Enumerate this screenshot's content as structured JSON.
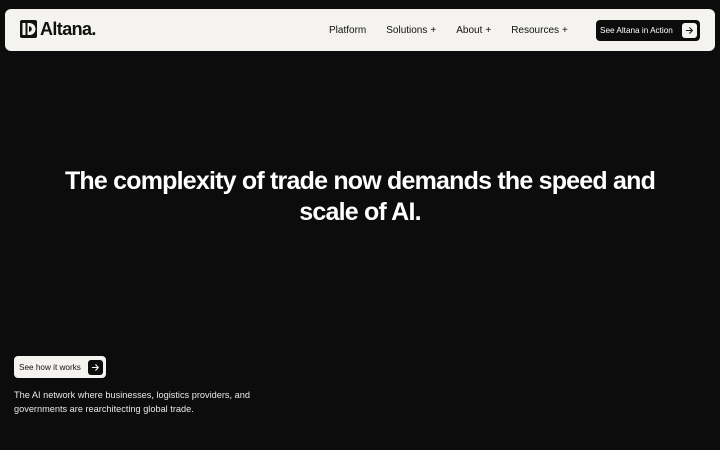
{
  "header": {
    "logo_text": "Altana.",
    "nav": [
      {
        "label": "Platform",
        "has_plus": false
      },
      {
        "label": "Solutions",
        "has_plus": true
      },
      {
        "label": "About",
        "has_plus": true
      },
      {
        "label": "Resources",
        "has_plus": true
      }
    ],
    "plus_symbol": "+",
    "cta_label": "See Altana in Action",
    "cta_icon": "arrow-right-icon"
  },
  "hero": {
    "headline": "The complexity of trade now demands the speed and scale of AI.",
    "cta_label": "See how it works",
    "cta_icon": "arrow-right-icon",
    "tagline": "The AI network where businesses, logistics providers, and governments are rearchitecting global trade."
  },
  "colors": {
    "background": "#0c0c0c",
    "navbar_background": "#f4f3ef",
    "text_primary": "#ffffff",
    "text_dark": "#111111"
  }
}
